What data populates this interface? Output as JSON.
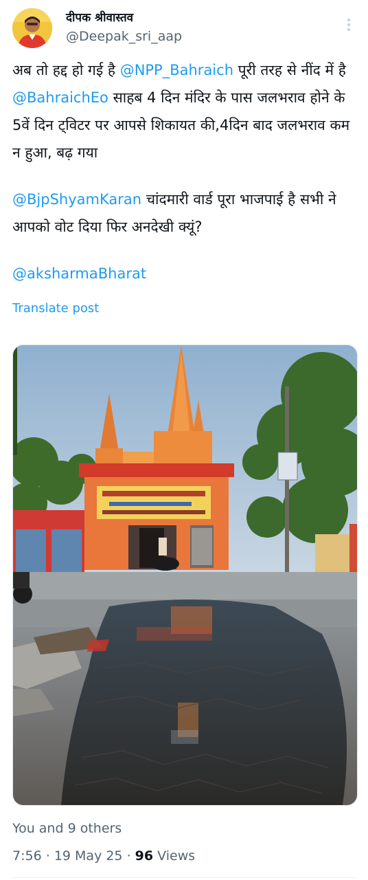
{
  "author": {
    "display_name": "दीपक श्रीवास्तव",
    "handle": "@Deepak_sri_aap",
    "avatar": "avatar"
  },
  "post": {
    "paragraphs": [
      [
        {
          "text": "अब तो हद्द हो गई है ",
          "type": "text"
        },
        {
          "text": "@NPP_Bahraich",
          "type": "mention"
        },
        {
          "text": " पूरी तरह से नींद में है ",
          "type": "text"
        },
        {
          "text": "@BahraichEo",
          "type": "mention"
        },
        {
          "text": " साहब 4 दिन मंदिर के पास जलभराव होने के 5वें दिन ट्विटर पर आपसे शिकायत की,4दिन बाद जलभराव कम न हुआ, बढ़ गया",
          "type": "text"
        }
      ],
      [
        {
          "text": "@BjpShyamKaran",
          "type": "mention"
        },
        {
          "text": " चांदमारी वार्ड पूरा भाजपाई है सभी ने आपको वोट दिया फिर अनदेखी क्यूं?",
          "type": "text"
        }
      ],
      [
        {
          "text": "@aksharmaBharat",
          "type": "mention"
        }
      ]
    ],
    "translate_label": "Translate post",
    "media": "photo of a waterlogged road beside a saffron temple"
  },
  "footer": {
    "likes_text": "You and 9 others",
    "time": "7:56",
    "date": "19 May 25",
    "separator": "·",
    "views_count": "96",
    "views_label": "Views"
  },
  "icons": {
    "more": "more-options-icon"
  },
  "colors": {
    "mention": "#1d9bf0",
    "secondary_text": "#536471",
    "primary_text": "#0f1419"
  }
}
